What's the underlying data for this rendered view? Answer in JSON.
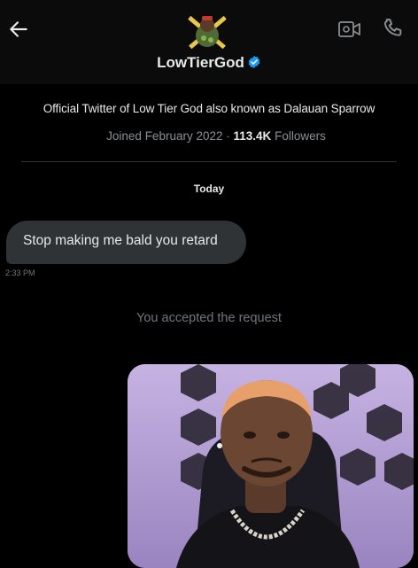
{
  "header": {
    "back_icon": "arrow-left-icon",
    "username": "LowTierGod",
    "verified_icon": "verified-badge-icon",
    "video_icon": "video-call-icon",
    "phone_icon": "phone-call-icon"
  },
  "profile": {
    "bio": "Official Twitter of Low Tier God also known as Dalauan Sparrow",
    "joined": "Joined February 2022 ·",
    "followers_count": "113.4K",
    "followers_label": "Followers"
  },
  "conversation": {
    "date_separator": "Today",
    "messages": [
      {
        "text": "Stop making me bald you retard",
        "time": "2:33 PM"
      }
    ],
    "system_message": "You accepted the request"
  },
  "colors": {
    "background": "#000000",
    "bubble": "#2f3336",
    "muted_text": "#71767b",
    "verified": "#1d9bf0"
  }
}
